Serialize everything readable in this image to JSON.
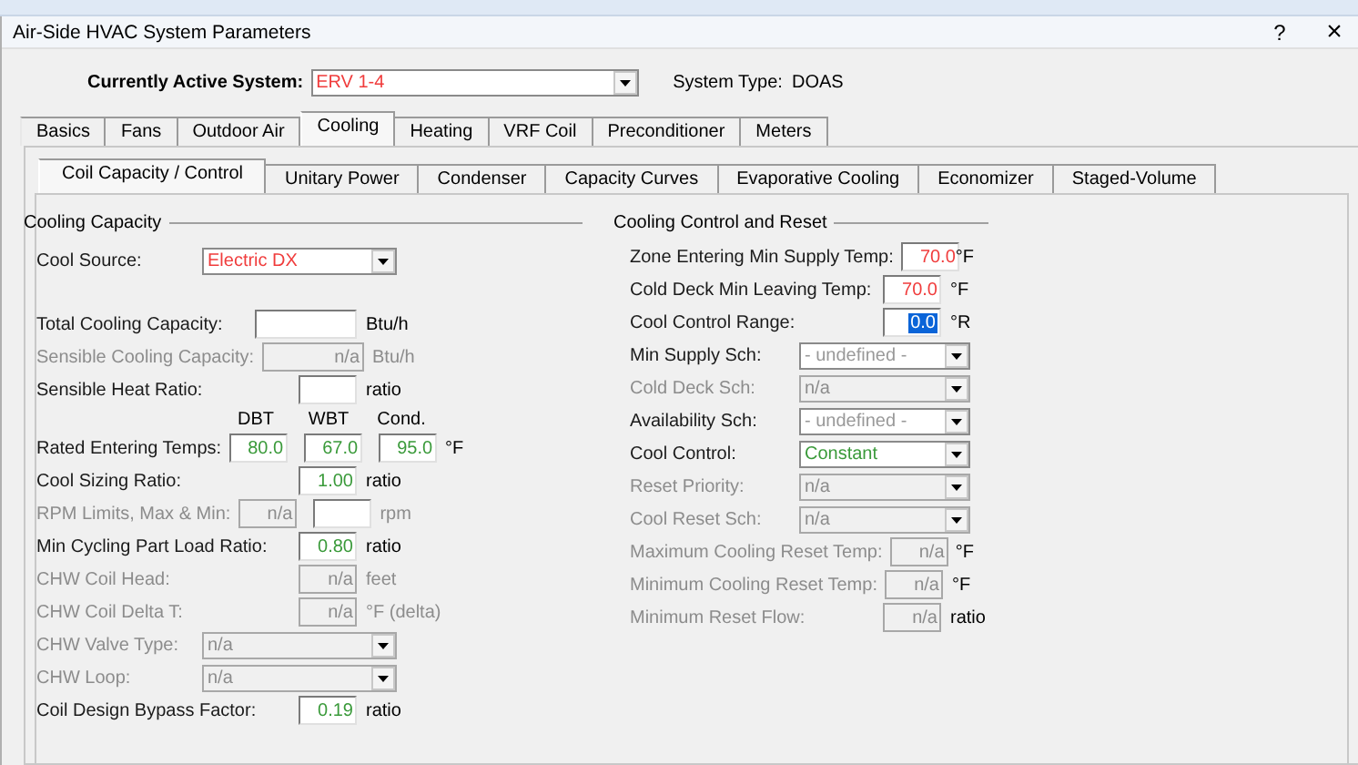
{
  "window": {
    "title": "Air-Side HVAC System Parameters",
    "help": "?",
    "close": "×"
  },
  "active_system": {
    "label": "Currently Active System:",
    "value": "ERV 1-4",
    "color": "#f03c3c"
  },
  "system_type": {
    "label": "System Type:",
    "value": "DOAS"
  },
  "tabs": [
    {
      "label": "Basics",
      "selected": false
    },
    {
      "label": "Fans",
      "selected": false
    },
    {
      "label": "Outdoor Air",
      "selected": false
    },
    {
      "label": "Cooling",
      "selected": true
    },
    {
      "label": "Heating",
      "selected": false
    },
    {
      "label": "VRF Coil",
      "selected": false
    },
    {
      "label": "Preconditioner",
      "selected": false
    },
    {
      "label": "Meters",
      "selected": false
    }
  ],
  "subtabs": [
    {
      "label": "Coil Capacity / Control",
      "selected": true
    },
    {
      "label": "Unitary Power",
      "selected": false
    },
    {
      "label": "Condenser",
      "selected": false
    },
    {
      "label": "Capacity Curves",
      "selected": false
    },
    {
      "label": "Evaporative Cooling",
      "selected": false
    },
    {
      "label": "Economizer",
      "selected": false
    },
    {
      "label": "Staged-Volume",
      "selected": false
    }
  ],
  "cooling_capacity": {
    "title": "Cooling Capacity",
    "rows": [
      {
        "kind": "dropdown",
        "label": "Cool Source:",
        "disabled": false,
        "value": "Electric DX",
        "color": "#f03c3c"
      },
      {
        "kind": "fields",
        "label": "Total Cooling Capacity:",
        "disabled": false,
        "fields": [
          {
            "wide": true,
            "disabled": false
          }
        ],
        "unit": "Btu/h"
      },
      {
        "kind": "fields",
        "label": "Sensible Cooling Capacity:",
        "disabled": true,
        "fields": [
          {
            "wide": true,
            "disabled": true,
            "value": "n/a"
          }
        ],
        "unit": "Btu/h"
      },
      {
        "kind": "fields",
        "label": "Sensible Heat Ratio:",
        "disabled": false,
        "fields": [
          {
            "disabled": false
          }
        ],
        "unit": "ratio"
      },
      {
        "kind": "temps",
        "label": "Rated Entering Temps:",
        "disabled": false,
        "fields": [
          {
            "heading": "DBT",
            "value": "80.0",
            "color": "#3a9a3a",
            "disabled": false
          },
          {
            "heading": "WBT",
            "value": "67.0",
            "color": "#3a9a3a",
            "disabled": false
          },
          {
            "heading": "Cond.",
            "value": "95.0",
            "color": "#3a9a3a",
            "disabled": false
          }
        ],
        "unit": "°F"
      },
      {
        "kind": "fields",
        "label": "Cool Sizing Ratio:",
        "disabled": false,
        "fields": [
          {
            "value": "1.00",
            "color": "#3a9a3a",
            "disabled": false
          }
        ],
        "unit": "ratio"
      },
      {
        "kind": "fields",
        "label": "RPM Limits, Max & Min:",
        "disabled": true,
        "fields": [
          {
            "value": "n/a",
            "disabled": true
          },
          {
            "disabled": false
          }
        ],
        "unit": "rpm"
      },
      {
        "kind": "fields",
        "label": "Min Cycling Part Load Ratio:",
        "disabled": false,
        "fields": [
          {
            "value": "0.80",
            "color": "#3a9a3a",
            "disabled": false
          }
        ],
        "unit": "ratio"
      },
      {
        "kind": "fields",
        "label": "CHW Coil Head:",
        "disabled": true,
        "fields": [
          {
            "value": "n/a",
            "disabled": true
          }
        ],
        "unit": "feet"
      },
      {
        "kind": "fields",
        "label": "CHW Coil Delta T:",
        "disabled": true,
        "fields": [
          {
            "value": "n/a",
            "disabled": true
          }
        ],
        "unit": "°F (delta)"
      },
      {
        "kind": "dropdown",
        "label": "CHW Valve Type:",
        "disabled": true,
        "value": "n/a"
      },
      {
        "kind": "dropdown",
        "label": "CHW Loop:",
        "disabled": true,
        "value": "n/a"
      },
      {
        "kind": "fields",
        "label": "Coil Design Bypass Factor:",
        "disabled": false,
        "fields": [
          {
            "value": "0.19",
            "color": "#3a9a3a",
            "disabled": false
          }
        ],
        "unit": "ratio"
      }
    ]
  },
  "cooling_control": {
    "title": "Cooling Control and Reset",
    "rows": [
      {
        "kind": "fields",
        "label": "Zone Entering Min Supply Temp:",
        "disabled": false,
        "fields": [
          {
            "value": "70.0",
            "color": "#f03c3c",
            "disabled": false
          }
        ],
        "unit": "°F"
      },
      {
        "kind": "fields",
        "label": "Cold Deck Min Leaving Temp:",
        "disabled": false,
        "fields": [
          {
            "value": "70.0",
            "color": "#f03c3c",
            "disabled": false
          }
        ],
        "unit": "°F"
      },
      {
        "kind": "fields",
        "label": "Cool Control Range:",
        "disabled": false,
        "fields": [
          {
            "value": "0.0",
            "disabled": false,
            "text_selected": true
          }
        ],
        "unit": "°R"
      },
      {
        "kind": "dropdown",
        "label": "Min Supply Sch:",
        "disabled": false,
        "value": "- undefined -",
        "color": "#999999"
      },
      {
        "kind": "dropdown",
        "label": "Cold Deck Sch:",
        "disabled": true,
        "value": "n/a"
      },
      {
        "kind": "dropdown",
        "label": "Availability Sch:",
        "disabled": false,
        "value": "- undefined -",
        "color": "#999999"
      },
      {
        "kind": "dropdown",
        "label": "Cool Control:",
        "disabled": false,
        "value": "Constant",
        "color": "#3a9a3a"
      },
      {
        "kind": "dropdown",
        "label": "Reset Priority:",
        "disabled": true,
        "value": "n/a"
      },
      {
        "kind": "dropdown",
        "label": "Cool Reset Sch:",
        "disabled": true,
        "value": "n/a"
      },
      {
        "kind": "fields",
        "label": "Maximum Cooling Reset Temp:",
        "disabled": true,
        "fields": [
          {
            "value": "n/a",
            "disabled": true
          }
        ],
        "unit": "°F"
      },
      {
        "kind": "fields",
        "label": "Minimum Cooling Reset Temp:",
        "disabled": true,
        "fields": [
          {
            "value": "n/a",
            "disabled": true
          }
        ],
        "unit": "°F"
      },
      {
        "kind": "fields",
        "label": "Minimum Reset Flow:",
        "disabled": true,
        "fields": [
          {
            "value": "n/a",
            "disabled": true
          }
        ],
        "unit": "ratio"
      }
    ]
  }
}
